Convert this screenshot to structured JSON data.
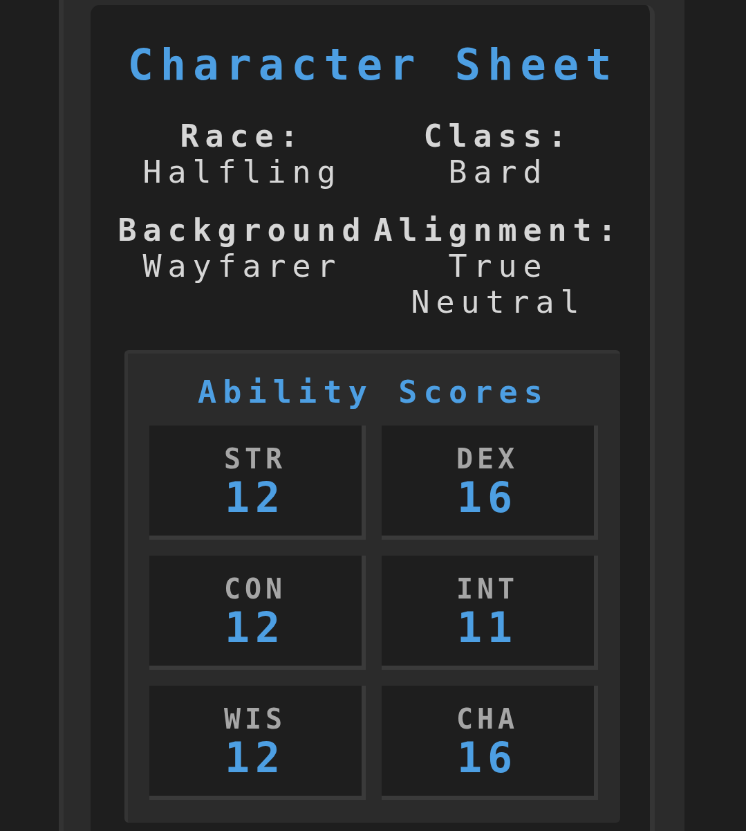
{
  "title": "Character Sheet",
  "details": [
    {
      "label": "Race:",
      "value": "Halfling"
    },
    {
      "label": "Class:",
      "value": "Bard"
    },
    {
      "label": "Background",
      "value": "Wayfarer"
    },
    {
      "label": "Alignment:",
      "value": "True Neutral"
    }
  ],
  "ability_scores": {
    "title": "Ability Scores",
    "scores": [
      {
        "name": "STR",
        "score": "12"
      },
      {
        "name": "DEX",
        "score": "16"
      },
      {
        "name": "CON",
        "score": "12"
      },
      {
        "name": "INT",
        "score": "11"
      },
      {
        "name": "WIS",
        "score": "12"
      },
      {
        "name": "CHA",
        "score": "16"
      }
    ]
  }
}
